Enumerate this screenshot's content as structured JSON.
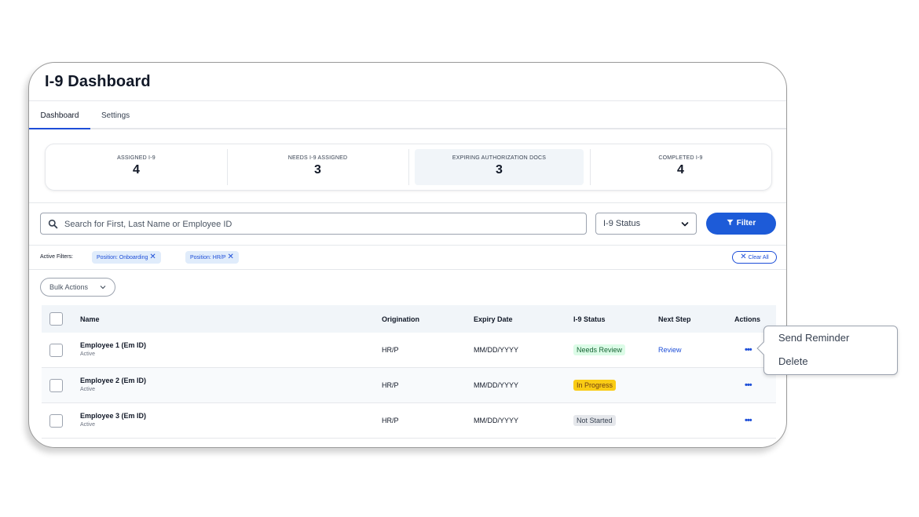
{
  "page": {
    "title": "I-9 Dashboard"
  },
  "tabs": [
    {
      "label": "Dashboard",
      "active": true
    },
    {
      "label": "Settings",
      "active": false
    }
  ],
  "stats": [
    {
      "label": "ASSIGNED I-9",
      "value": "4"
    },
    {
      "label": "NEEDS I-9 ASSIGNED",
      "value": "3"
    },
    {
      "label": "EXPIRING AUTHORIZATION DOCS",
      "value": "3",
      "highlighted": true
    },
    {
      "label": "COMPLETED I-9",
      "value": "4"
    }
  ],
  "search": {
    "placeholder": "Search for First, Last Name or Employee ID",
    "value": ""
  },
  "status_select": {
    "value": "I-9 Status"
  },
  "filter_button": {
    "label": "Filter"
  },
  "active_filters": {
    "label": "Active Filters:",
    "chips": [
      "Position: Onboarding",
      "Position: HR/P"
    ],
    "clear_all": "Clear All"
  },
  "bulk_actions": {
    "label": "Bulk Actions"
  },
  "table": {
    "columns": [
      "Name",
      "Origination",
      "Expiry Date",
      "I-9 Status",
      "Next Step",
      "Actions"
    ],
    "rows": [
      {
        "name": "Employee 1 (Em ID)",
        "sub": "Active",
        "origination": "HR/P",
        "expiry": "MM/DD/YYYY",
        "status": "Needs Review",
        "next_step": "Review",
        "actions": "•••"
      },
      {
        "name": "Employee 2 (Em ID)",
        "sub": "Active",
        "origination": "HR/P",
        "expiry": "MM/DD/YYYY",
        "status": "In Progress",
        "next_step": "",
        "actions": "•••"
      },
      {
        "name": "Employee 3 (Em ID)",
        "sub": "Active",
        "origination": "HR/P",
        "expiry": "MM/DD/YYYY",
        "status": "Not Started",
        "next_step": "",
        "actions": "•••"
      }
    ]
  },
  "actions_menu": {
    "items": [
      "Send Reminder",
      "Delete"
    ]
  },
  "icons": {
    "search": "search-icon",
    "chevron": "chevron-down-icon",
    "filter": "filter-icon",
    "close": "close-icon",
    "more": "more-horizontal-icon"
  },
  "colors": {
    "accent": "#1d5bd8",
    "needs_review": "#dcfce7",
    "in_progress": "#facc15",
    "not_started": "#e5e7eb"
  }
}
